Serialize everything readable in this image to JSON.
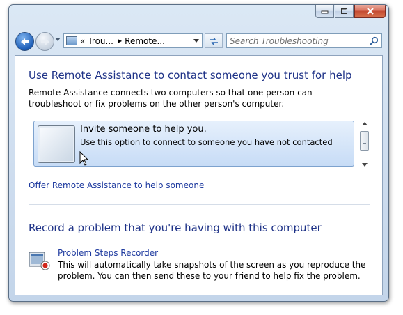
{
  "window": {
    "caption_buttons": {
      "minimize_icon": "minimize-icon",
      "maximize_icon": "maximize-icon",
      "close_icon": "close-icon"
    }
  },
  "navbar": {
    "back_icon": "back-arrow-icon",
    "forward_icon": "forward-arrow-icon",
    "address": {
      "prefix": "«",
      "segment1": "Trou...",
      "separator": "▶",
      "segment2": "Remote..."
    },
    "search_placeholder": "Search Troubleshooting"
  },
  "main": {
    "heading": "Use Remote Assistance to contact someone you trust for help",
    "description": "Remote Assistance connects two computers so that one person can troubleshoot or fix problems on the other person's computer.",
    "invite": {
      "title": "Invite someone to help you.",
      "subtitle": "Use this option to connect to someone you have not contacted"
    },
    "offer_link": "Offer Remote Assistance to help someone",
    "record_heading": "Record a problem that you're having with this computer",
    "psr": {
      "link": "Problem Steps Recorder",
      "description": "This will automatically take snapshots of the screen as you reproduce the problem. You can then send these to your friend to help fix the problem."
    }
  },
  "colors": {
    "heading": "#1e3287",
    "link": "#1e3a9f",
    "frame": "#cddcee",
    "close_button": "#c44b32"
  }
}
